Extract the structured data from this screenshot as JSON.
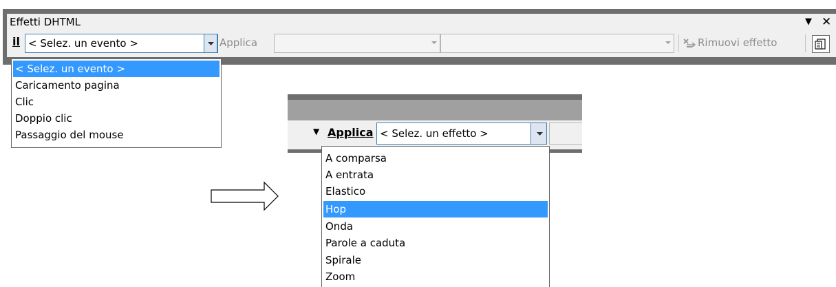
{
  "toolbar1": {
    "title": "Effetti DHTML",
    "menu_glyph": "▼",
    "close_glyph": "✕",
    "label_fragment": "il",
    "event_combo_value": "< Selez. un evento >",
    "apply_label": "Applica",
    "effect_combo_value": "",
    "effect_option_combo_value": "",
    "remove_effect_label": "Rimuovi effetto",
    "icons": [
      "chevron-down-icon",
      "remove-effect-icon",
      "page-icon"
    ]
  },
  "event_dropdown": {
    "items": [
      {
        "label": "< Selez. un evento >",
        "selected": true
      },
      {
        "label": "Caricamento pagina",
        "selected": false
      },
      {
        "label": "Clic",
        "selected": false
      },
      {
        "label": "Doppio clic",
        "selected": false
      },
      {
        "label": "Passaggio del mouse",
        "selected": false
      }
    ]
  },
  "toolbar2": {
    "apply_label": "Applica",
    "effect_combo_value": "< Selez. un effetto >"
  },
  "effect_dropdown": {
    "items": [
      {
        "label": "A comparsa",
        "selected": false
      },
      {
        "label": "A entrata",
        "selected": false
      },
      {
        "label": "Elastico",
        "selected": false
      },
      {
        "label": "Hop",
        "selected": true
      },
      {
        "label": "Onda",
        "selected": false
      },
      {
        "label": "Parole a caduta",
        "selected": false
      },
      {
        "label": "Spirale",
        "selected": false
      },
      {
        "label": "Zoom",
        "selected": false
      }
    ]
  },
  "colors": {
    "selection": "#3399ff",
    "title_bar": "#6e6e6e",
    "toolbar_bg": "#f0f0f0",
    "disabled_text": "#8b8b8b",
    "focus_border": "#3c7fb1"
  }
}
